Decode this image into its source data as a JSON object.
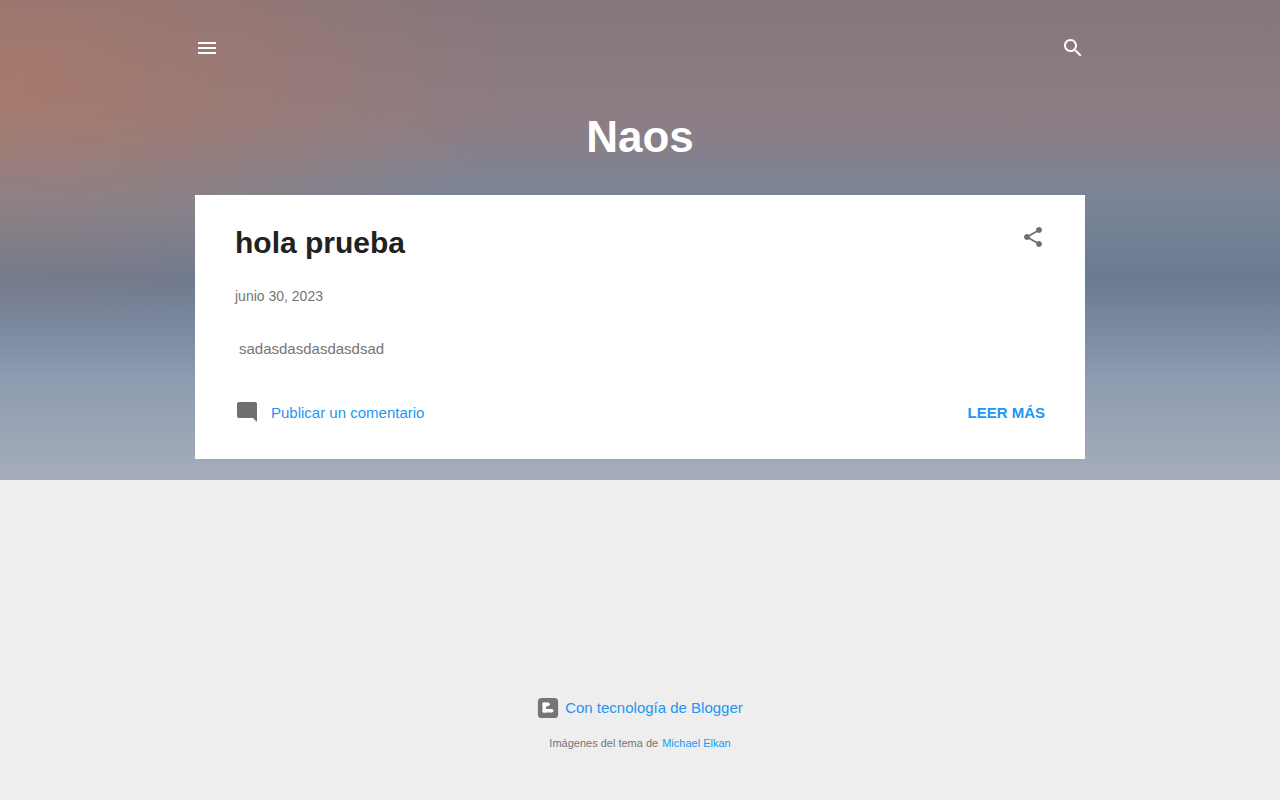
{
  "header": {
    "title": "Naos"
  },
  "post": {
    "title": "hola prueba",
    "date": "junio 30, 2023",
    "snippet": "sadasdasdasdasdsad",
    "comment_link": "Publicar un comentario",
    "read_more": "LEER MÁS"
  },
  "footer": {
    "powered_by": "Con tecnología de Blogger",
    "credit_prefix": "Imágenes del tema de",
    "credit_author": "Michael Elkan"
  }
}
